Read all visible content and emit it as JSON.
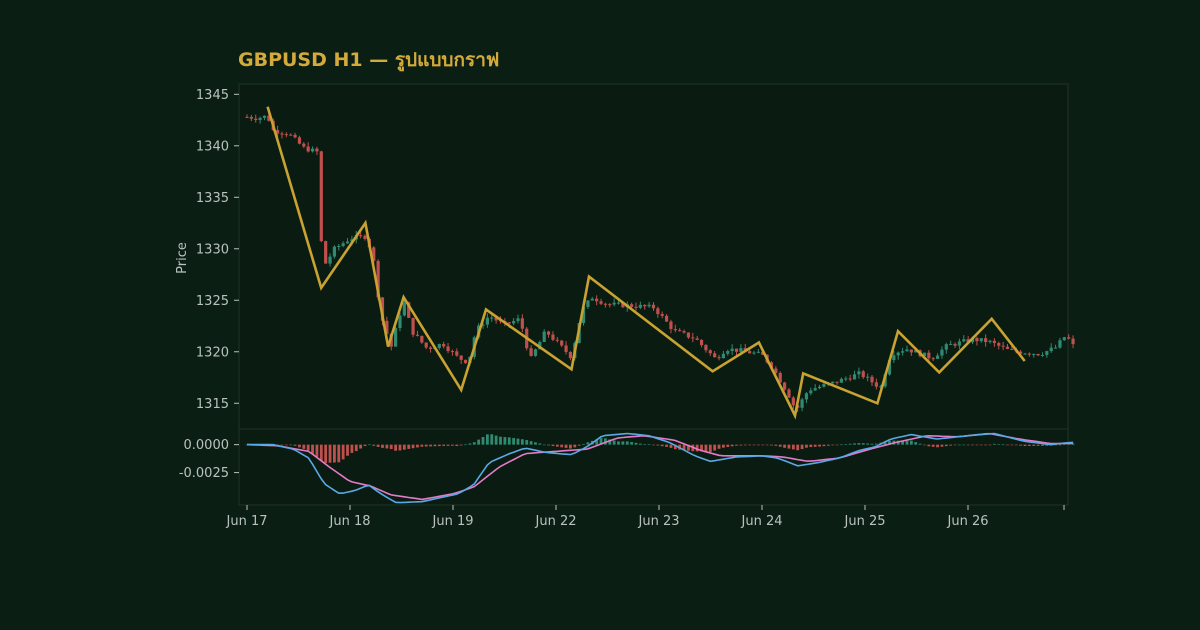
{
  "colors": {
    "background": "#0b1e14",
    "panel": "#0a1c11",
    "title": "#d4aa3a",
    "text": "#b9c2bd",
    "bull": "#2f8a71",
    "bear": "#c0504d",
    "zigzag": "#c9a232",
    "macd_line": "#5aa9e6",
    "signal_line": "#e57bc8",
    "hist_pos": "#2f8a71",
    "hist_neg": "#c0504d",
    "border": "#1e3328"
  },
  "chart_data": {
    "type": "candlestick",
    "title": "GBPUSD H1 — รูปแบบกราฟ",
    "ylabel": "Price",
    "price_axis": {
      "ylim": [
        1312.5,
        1346
      ],
      "ticks": [
        1315,
        1320,
        1325,
        1330,
        1335,
        1340,
        1345
      ]
    },
    "macd_axis": {
      "ylim": [
        -0.0054,
        0.0014
      ],
      "ticks": [
        0.0,
        -0.0025
      ],
      "tick_labels": [
        "0.0000",
        "-0.0025"
      ]
    },
    "x_ticks": [
      "Jun 17",
      "Jun 18",
      "Jun 19",
      "Jun 22",
      "Jun 23",
      "Jun 24",
      "Jun 25",
      "Jun 26"
    ],
    "x_tick_positions": [
      0,
      1,
      2,
      3,
      4,
      5,
      6,
      7
    ],
    "x_range": [
      -0.05,
      8.1
    ],
    "zigzag_points": [
      [
        0.2,
        1343.8
      ],
      [
        0.72,
        1326.2
      ],
      [
        1.15,
        1332.5
      ],
      [
        1.37,
        1320.5
      ],
      [
        1.52,
        1325.3
      ],
      [
        2.08,
        1316.3
      ],
      [
        2.32,
        1324.1
      ],
      [
        3.15,
        1318.3
      ],
      [
        3.32,
        1327.3
      ],
      [
        4.52,
        1318.1
      ],
      [
        4.97,
        1320.9
      ],
      [
        5.32,
        1313.8
      ],
      [
        5.4,
        1317.9
      ],
      [
        6.12,
        1315.0
      ],
      [
        6.32,
        1322.0
      ],
      [
        6.72,
        1318.0
      ],
      [
        7.23,
        1323.2
      ],
      [
        7.55,
        1319.1
      ]
    ],
    "macd_keypoints": [
      [
        0.0,
        0.0
      ],
      [
        0.25,
        0.0
      ],
      [
        0.45,
        -0.0004
      ],
      [
        0.6,
        -0.0012
      ],
      [
        0.75,
        -0.0035
      ],
      [
        0.9,
        -0.0044
      ],
      [
        1.05,
        -0.0041
      ],
      [
        1.18,
        -0.0036
      ],
      [
        1.3,
        -0.0044
      ],
      [
        1.45,
        -0.0052
      ],
      [
        1.7,
        -0.0051
      ],
      [
        2.05,
        -0.0044
      ],
      [
        2.2,
        -0.0036
      ],
      [
        2.35,
        -0.0016
      ],
      [
        2.55,
        -0.0008
      ],
      [
        2.7,
        -0.0003
      ],
      [
        2.9,
        -0.0007
      ],
      [
        3.15,
        -0.0009
      ],
      [
        3.3,
        -0.0002
      ],
      [
        3.45,
        0.0008
      ],
      [
        3.7,
        0.001
      ],
      [
        3.9,
        0.0008
      ],
      [
        4.1,
        0.0002
      ],
      [
        4.35,
        -0.001
      ],
      [
        4.5,
        -0.0015
      ],
      [
        4.75,
        -0.0011
      ],
      [
        5.0,
        -0.001
      ],
      [
        5.15,
        -0.0012
      ],
      [
        5.35,
        -0.0019
      ],
      [
        5.55,
        -0.0016
      ],
      [
        5.75,
        -0.0012
      ],
      [
        5.95,
        -0.0005
      ],
      [
        6.1,
        -0.0002
      ],
      [
        6.25,
        0.0005
      ],
      [
        6.45,
        0.0009
      ],
      [
        6.7,
        0.0005
      ],
      [
        7.0,
        0.0008
      ],
      [
        7.25,
        0.001
      ],
      [
        7.55,
        0.0003
      ],
      [
        7.8,
        0.0
      ],
      [
        8.0,
        0.0002
      ]
    ],
    "signal_keypoints": [
      [
        0.0,
        0.0
      ],
      [
        0.3,
        -0.0001
      ],
      [
        0.6,
        -0.0006
      ],
      [
        0.8,
        -0.002
      ],
      [
        1.0,
        -0.0033
      ],
      [
        1.2,
        -0.0037
      ],
      [
        1.4,
        -0.0045
      ],
      [
        1.7,
        -0.0049
      ],
      [
        2.0,
        -0.0044
      ],
      [
        2.2,
        -0.0038
      ],
      [
        2.45,
        -0.002
      ],
      [
        2.7,
        -0.0008
      ],
      [
        3.0,
        -0.0006
      ],
      [
        3.3,
        -0.0004
      ],
      [
        3.6,
        0.0006
      ],
      [
        3.85,
        0.0008
      ],
      [
        4.15,
        0.0004
      ],
      [
        4.4,
        -0.0005
      ],
      [
        4.6,
        -0.001
      ],
      [
        5.0,
        -0.001
      ],
      [
        5.2,
        -0.0011
      ],
      [
        5.45,
        -0.0015
      ],
      [
        5.75,
        -0.0012
      ],
      [
        6.05,
        -0.0004
      ],
      [
        6.3,
        0.0002
      ],
      [
        6.6,
        0.0008
      ],
      [
        6.9,
        0.0007
      ],
      [
        7.2,
        0.001
      ],
      [
        7.5,
        0.0005
      ],
      [
        7.8,
        0.0001
      ],
      [
        8.0,
        0.0001
      ]
    ],
    "candle_keypoints": [
      [
        0.0,
        1342.8
      ],
      [
        0.1,
        1342.7
      ],
      [
        0.2,
        1342.9
      ],
      [
        0.25,
        1341.5
      ],
      [
        0.4,
        1341.2
      ],
      [
        0.55,
        1339.8
      ],
      [
        0.68,
        1339.4
      ],
      [
        0.7,
        1333.5
      ],
      [
        0.74,
        1328.2
      ],
      [
        0.85,
        1330.0
      ],
      [
        1.0,
        1331.0
      ],
      [
        1.15,
        1331.2
      ],
      [
        1.22,
        1329.5
      ],
      [
        1.3,
        1323.5
      ],
      [
        1.4,
        1320.5
      ],
      [
        1.52,
        1325.0
      ],
      [
        1.6,
        1322.0
      ],
      [
        1.75,
        1320.3
      ],
      [
        1.9,
        1320.8
      ],
      [
        2.05,
        1319.4
      ],
      [
        2.15,
        1319.0
      ],
      [
        2.22,
        1322.0
      ],
      [
        2.35,
        1323.5
      ],
      [
        2.5,
        1322.6
      ],
      [
        2.65,
        1323.2
      ],
      [
        2.75,
        1319.2
      ],
      [
        2.9,
        1322.0
      ],
      [
        3.05,
        1320.5
      ],
      [
        3.15,
        1319.5
      ],
      [
        3.25,
        1324.0
      ],
      [
        3.35,
        1325.3
      ],
      [
        3.5,
        1324.6
      ],
      [
        3.7,
        1324.5
      ],
      [
        3.95,
        1324.3
      ],
      [
        4.15,
        1322.0
      ],
      [
        4.35,
        1321.3
      ],
      [
        4.55,
        1319.3
      ],
      [
        4.65,
        1320.3
      ],
      [
        4.8,
        1320.1
      ],
      [
        5.0,
        1319.7
      ],
      [
        5.1,
        1318.5
      ],
      [
        5.25,
        1316.0
      ],
      [
        5.33,
        1314.3
      ],
      [
        5.45,
        1316.3
      ],
      [
        5.7,
        1317.0
      ],
      [
        5.95,
        1317.9
      ],
      [
        6.15,
        1316.5
      ],
      [
        6.25,
        1319.8
      ],
      [
        6.4,
        1320.3
      ],
      [
        6.65,
        1319.4
      ],
      [
        6.8,
        1320.6
      ],
      [
        7.05,
        1321.2
      ],
      [
        7.2,
        1321.0
      ],
      [
        7.4,
        1320.1
      ],
      [
        7.7,
        1319.8
      ],
      [
        7.85,
        1320.4
      ],
      [
        7.95,
        1321.6
      ],
      [
        8.02,
        1320.6
      ]
    ],
    "candle_count": 190
  }
}
